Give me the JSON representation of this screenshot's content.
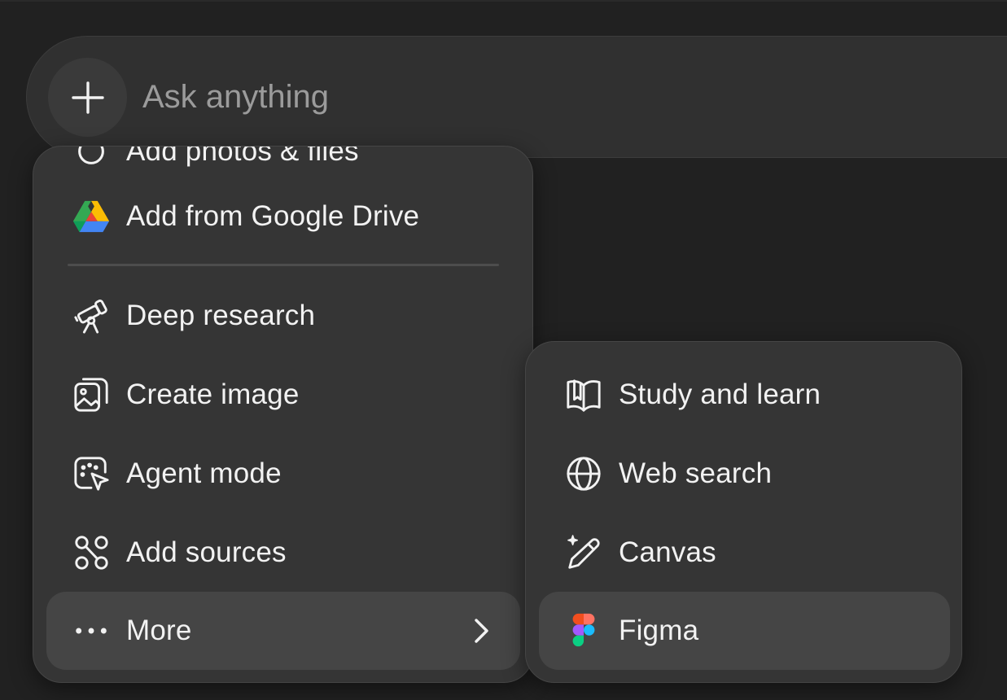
{
  "composer": {
    "placeholder": "Ask anything",
    "plus_icon": "plus-icon"
  },
  "main_menu": {
    "items": [
      {
        "label": "Add photos & files",
        "icon": "paperclip-icon"
      },
      {
        "label": "Add from Google Drive",
        "icon": "google-drive-icon"
      },
      {
        "label": "Deep research",
        "icon": "telescope-icon"
      },
      {
        "label": "Create image",
        "icon": "image-icon"
      },
      {
        "label": "Agent mode",
        "icon": "agent-cursor-icon"
      },
      {
        "label": "Add sources",
        "icon": "sources-icon"
      },
      {
        "label": "More",
        "icon": "more-dots-icon",
        "submenu_icon": "chevron-right-icon"
      }
    ]
  },
  "sub_menu": {
    "items": [
      {
        "label": "Study and learn",
        "icon": "book-icon"
      },
      {
        "label": "Web search",
        "icon": "globe-icon"
      },
      {
        "label": "Canvas",
        "icon": "canvas-pencil-icon"
      },
      {
        "label": "Figma",
        "icon": "figma-icon"
      }
    ]
  },
  "colors": {
    "background": "#212121",
    "composer": "#303030",
    "menu": "#353535",
    "hover": "#454545",
    "text": "#f2f2f2",
    "placeholder": "#9b9b9b"
  }
}
